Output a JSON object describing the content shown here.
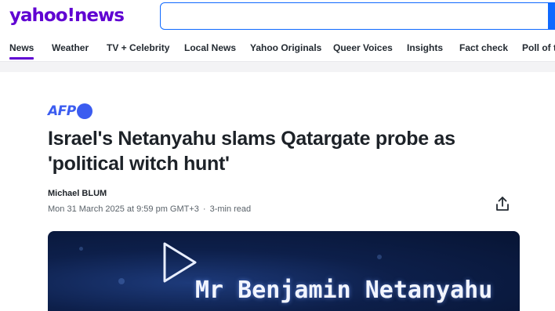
{
  "header": {
    "logo_text": "yahoo!news",
    "search": {
      "value": "",
      "placeholder": ""
    }
  },
  "nav": {
    "items": [
      {
        "label": "News",
        "active": true
      },
      {
        "label": "Weather"
      },
      {
        "label": "TV + Celebrity"
      },
      {
        "label": "Local News"
      },
      {
        "label": "Yahoo Originals"
      },
      {
        "label": "Queer Voices"
      },
      {
        "label": "Insights"
      },
      {
        "label": "Fact check"
      },
      {
        "label": "Poll of th"
      }
    ]
  },
  "article": {
    "source": "AFP",
    "headline": "Israel's Netanyahu slams Qatargate probe as 'political witch hunt'",
    "author": "Michael BLUM",
    "date": "Mon 31 March 2025 at 9:59 pm GMT+3",
    "separator": "·",
    "read_time": "3-min read",
    "video_caption": "Mr Benjamin Netanyahu"
  },
  "icons": {
    "share": "share-icon",
    "play": "play-icon"
  },
  "colors": {
    "brand": "#6001d2",
    "search_accent": "#0f69ff",
    "afp_blue": "#3b5cf0"
  }
}
